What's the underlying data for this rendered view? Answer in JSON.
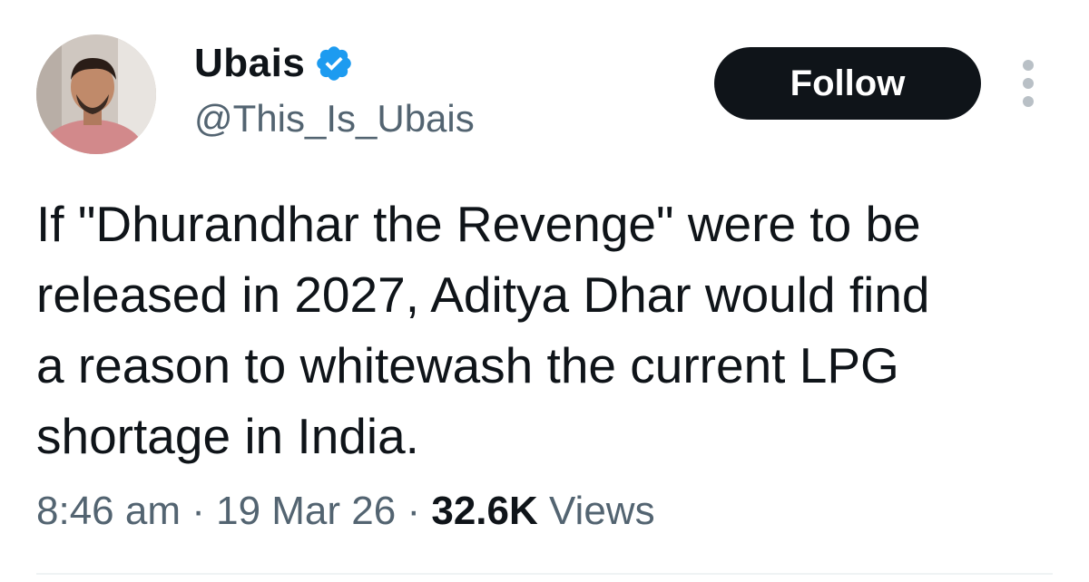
{
  "author": {
    "display_name": "Ubais",
    "handle": "@This_Is_Ubais",
    "verified": true,
    "verified_icon": "verified-badge-icon"
  },
  "actions": {
    "follow_label": "Follow",
    "more_icon": "more-vertical-icon"
  },
  "tweet": {
    "text": "If \"Dhurandhar the Revenge\" were to be\nreleased in 2027, Aditya Dhar would find\na reason to whitewash the current LPG\nshortage in India."
  },
  "meta": {
    "time": "8:46 am",
    "separator": "·",
    "date": "19 Mar 26",
    "views_count": "32.6K",
    "views_label": "Views"
  },
  "colors": {
    "text": "#0f1419",
    "secondary_text": "#536471",
    "verified_blue": "#1d9bf0",
    "follow_bg": "#0f1419",
    "follow_text": "#ffffff"
  }
}
